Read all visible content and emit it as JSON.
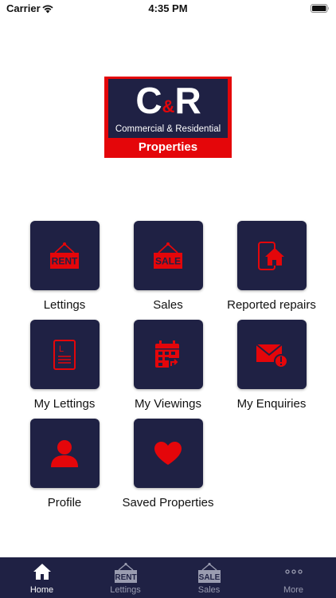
{
  "status": {
    "carrier": "Carrier",
    "time": "4:35 PM"
  },
  "logo": {
    "letter_c": "C",
    "ampersand": "&",
    "letter_r": "R",
    "subtitle": "Commercial & Residential",
    "tagline": "Properties"
  },
  "tiles": [
    {
      "label": "Lettings",
      "icon": "rent-sign-icon"
    },
    {
      "label": "Sales",
      "icon": "sale-sign-icon"
    },
    {
      "label": "Reported repairs",
      "icon": "phone-house-icon"
    },
    {
      "label": "My Lettings",
      "icon": "document-icon"
    },
    {
      "label": "My Viewings",
      "icon": "calendar-icon"
    },
    {
      "label": "My Enquiries",
      "icon": "mail-alert-icon"
    },
    {
      "label": "Profile",
      "icon": "person-icon"
    },
    {
      "label": "Saved Properties",
      "icon": "heart-icon"
    }
  ],
  "icon_text": {
    "rent": "RENT",
    "sale": "SALE",
    "doc_letter": "L"
  },
  "tabbar": {
    "active": "Home",
    "items": [
      {
        "label": "Home",
        "icon": "home-icon"
      },
      {
        "label": "Lettings",
        "icon": "rent-sign-icon"
      },
      {
        "label": "Sales",
        "icon": "sale-sign-icon"
      },
      {
        "label": "More",
        "icon": "more-dots-icon"
      }
    ]
  },
  "colors": {
    "navy": "#1f2144",
    "red": "#e4060a",
    "white": "#ffffff",
    "inactive": "#9a9cb0"
  }
}
